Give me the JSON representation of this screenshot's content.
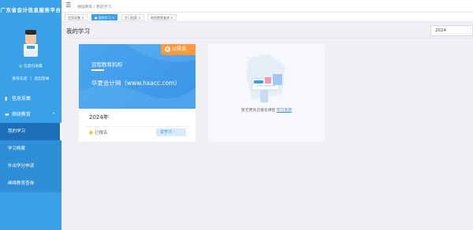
{
  "sidebar": {
    "title": "广东省会计信息服务平台",
    "status_text": "信息已采集",
    "actions": [
      "账号信息",
      "退出登录"
    ],
    "menu": [
      {
        "label": "信息采集",
        "icon": "document-icon"
      },
      {
        "label": "继续教育",
        "icon": "book-icon"
      }
    ],
    "submenu": [
      "我的学习",
      "学习档案",
      "外出学分申请",
      "继续教育查询"
    ]
  },
  "topbar": {
    "breadcrumb": [
      "继续教育",
      "我的学习"
    ]
  },
  "tabs": [
    "信息采集",
    "我的学习",
    "学习档案",
    "继续教育查询"
  ],
  "page": {
    "title": "我的学习",
    "year_select_value": "2024"
  },
  "course_card": {
    "tag": "公需课",
    "banner_line1": "远程教育机构",
    "banner_line2": "华夏会计网（www.hxacc.com）",
    "year": "2024年",
    "status": "已报名",
    "button": "去学习"
  },
  "empty_card": {
    "text": "暂无更多已报名课程",
    "link": "学习资源"
  },
  "colors": {
    "sidebar": "#3aa0e8",
    "accent": "#3a8fd9",
    "tag": "#ff9a3c"
  }
}
